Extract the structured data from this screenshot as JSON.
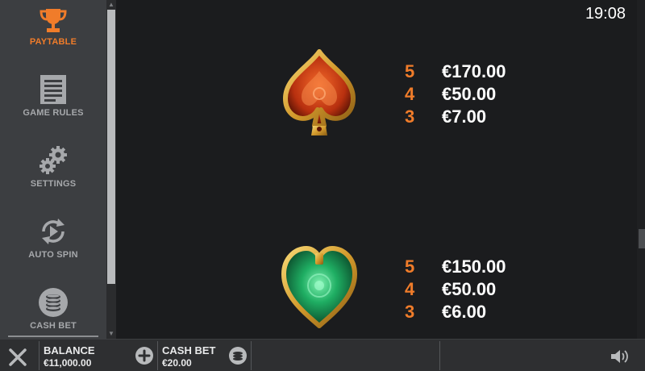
{
  "sidebar": {
    "items": [
      {
        "label": "PAYTABLE",
        "icon": "trophy-icon",
        "active": true
      },
      {
        "label": "GAME RULES",
        "icon": "document-icon",
        "active": false
      },
      {
        "label": "SETTINGS",
        "icon": "gears-icon",
        "active": false
      },
      {
        "label": "AUTO SPIN",
        "icon": "auto-spin-icon",
        "active": false
      },
      {
        "label": "CASH BET",
        "icon": "coins-icon",
        "active": false
      }
    ]
  },
  "status": {
    "clock": "19:08"
  },
  "paytable": {
    "symbols": [
      {
        "symbol": "spade-icon",
        "payouts": [
          {
            "count": "5",
            "amount": "€170.00"
          },
          {
            "count": "4",
            "amount": "€50.00"
          },
          {
            "count": "3",
            "amount": "€7.00"
          }
        ]
      },
      {
        "symbol": "heart-icon",
        "payouts": [
          {
            "count": "5",
            "amount": "€150.00"
          },
          {
            "count": "4",
            "amount": "€50.00"
          },
          {
            "count": "3",
            "amount": "€6.00"
          }
        ]
      }
    ]
  },
  "bottombar": {
    "balance_label": "BALANCE",
    "balance_value": "€11,000.00",
    "cashbet_label": "CASH BET",
    "cashbet_value": "€20.00"
  },
  "colors": {
    "accent": "#f07c2a",
    "sidebar_bg": "#3c3e41",
    "main_bg": "#1b1c1e",
    "spade": "#d9441c",
    "heart": "#1f9e5a",
    "gold": "#e2a736"
  }
}
